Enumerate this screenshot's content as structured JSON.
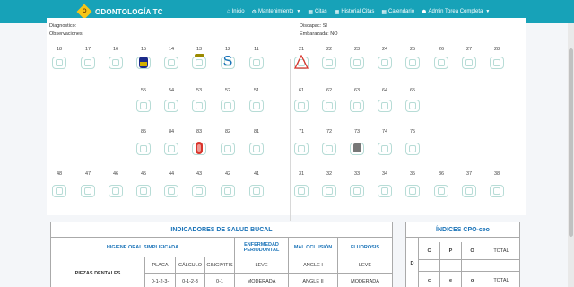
{
  "navbar": {
    "brand_logo_text": "O",
    "brand": "ODONTOLOGÍA TC",
    "items": [
      {
        "icon": "home-icon",
        "glyph": "⌂",
        "label": "Inicio",
        "caret": false
      },
      {
        "icon": "gears-icon",
        "glyph": "⚙",
        "label": "Mantenimiento",
        "caret": true
      },
      {
        "icon": "calendar-icon",
        "glyph": "▦",
        "label": "Citas",
        "caret": false
      },
      {
        "icon": "history-icon",
        "glyph": "▦",
        "label": "Historial Citas",
        "caret": false
      },
      {
        "icon": "calendar-icon",
        "glyph": "▦",
        "label": "Calendario",
        "caret": false
      },
      {
        "icon": "users-icon",
        "glyph": "☗",
        "label": "Admin Torea Completa",
        "caret": true
      }
    ],
    "color": "#17a2b8"
  },
  "patient_info": {
    "diagnostico_label": "Diagnostico:",
    "observaciones_label": "Observaciones:",
    "discapacidad_label": "Discapac:",
    "discapacidad_value": "SI",
    "embarazada_label": "Embarazada:",
    "embarazada_value": "NO"
  },
  "odontogram": {
    "row1": [
      "18",
      "17",
      "16",
      "15",
      "14",
      "13",
      "12",
      "11",
      "21",
      "22",
      "23",
      "24",
      "25",
      "26",
      "27",
      "28"
    ],
    "row2": [
      "55",
      "54",
      "53",
      "52",
      "51",
      "61",
      "62",
      "63",
      "64",
      "65"
    ],
    "row3": [
      "85",
      "84",
      "83",
      "82",
      "81",
      "71",
      "72",
      "73",
      "74",
      "75"
    ],
    "row4": [
      "48",
      "47",
      "46",
      "45",
      "44",
      "43",
      "42",
      "41",
      "31",
      "32",
      "33",
      "34",
      "35",
      "36",
      "37",
      "38"
    ],
    "marks": {
      "t15": {
        "type": "crown",
        "colors": [
          "#1c2a8a",
          "#d4b000"
        ]
      },
      "t13": {
        "type": "bar",
        "color": "#9a8a00"
      },
      "t12": {
        "type": "letter",
        "text": "S",
        "color": "#1a73b8"
      },
      "t21": {
        "type": "triangle",
        "color": "#d9342b"
      },
      "t83": {
        "type": "pill",
        "color": "#d9342b"
      },
      "t73": {
        "type": "square",
        "color": "#777"
      }
    }
  },
  "indicadores": {
    "title": "INDICADORES DE SALUD BUCAL",
    "higiene": "HIGIENE ORAL SIMPLIFICADA",
    "enfermedad": "ENFERMEDAD PERIODONTAL",
    "maloclusion": "MAL OCLUSIÓN",
    "fluorosis": "FLUOROSIS",
    "piezas": "PIEZAS DENTALES",
    "placa": "PLACA",
    "calculo": "CÁLCULO",
    "gingivitis": "GINGIVITIS",
    "placa_range": "0-1-2-3-",
    "calculo_range": "0-1-2-3",
    "gingivitis_range": "0-1",
    "leve": "LEVE",
    "moderada": "MODERADA",
    "angle1": "ANGLE I",
    "angle2": "ANGLE II",
    "leve_f": "LEVE",
    "moderada_f": "MODERADA"
  },
  "cpo": {
    "title": "ÍNDICES CPO-ceo",
    "D": "D",
    "C": "C",
    "P": "P",
    "O": "O",
    "total": "TOTAL",
    "d2": "d",
    "c2": "c",
    "e2": "e",
    "o2": "o",
    "total2": "TOTAL"
  }
}
